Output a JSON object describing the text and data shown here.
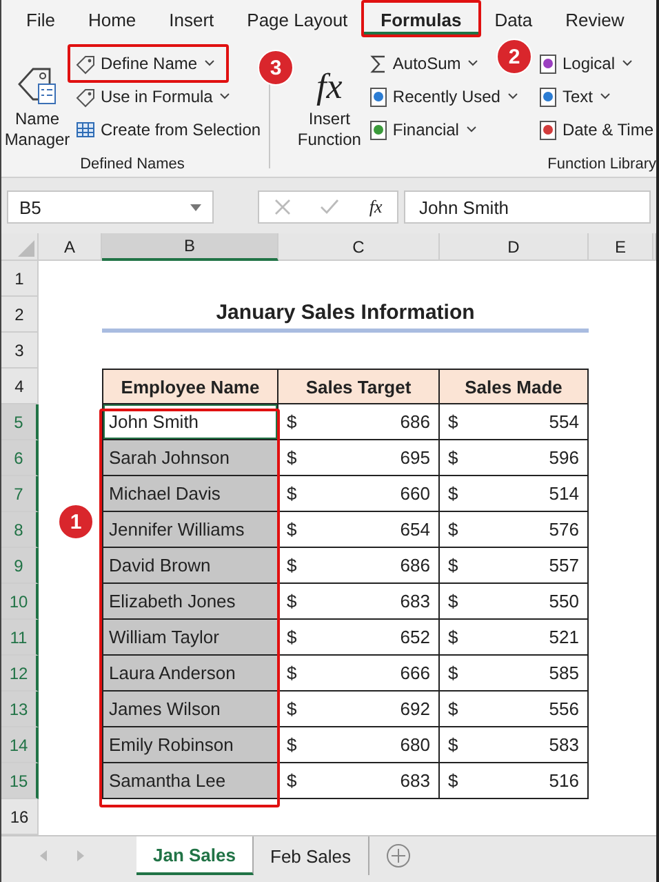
{
  "ribbon_tabs": [
    {
      "label": "File",
      "selected": false
    },
    {
      "label": "Home",
      "selected": false
    },
    {
      "label": "Insert",
      "selected": false
    },
    {
      "label": "Page Layout",
      "selected": false
    },
    {
      "label": "Formulas",
      "selected": true
    },
    {
      "label": "Data",
      "selected": false
    },
    {
      "label": "Review",
      "selected": false
    }
  ],
  "ribbon_groups": [
    {
      "label": "Defined Names",
      "large": [
        {
          "label": "Name Manager"
        }
      ],
      "small": [
        {
          "label": "Define Name",
          "dropdown": true
        },
        {
          "label": "Use in Formula",
          "dropdown": true
        },
        {
          "label": "Create from Selection",
          "dropdown": false
        }
      ]
    },
    {
      "label": "Function Library",
      "large": [
        {
          "label": "Insert Function",
          "glyph": "fx"
        }
      ],
      "small": [
        {
          "label": "AutoSum",
          "dropdown": true
        },
        {
          "label": "Recently Used",
          "dropdown": true
        },
        {
          "label": "Financial",
          "dropdown": true
        },
        {
          "label": "Logical",
          "dropdown": true
        },
        {
          "label": "Text",
          "dropdown": true
        },
        {
          "label": "Date & Time",
          "dropdown": false
        }
      ]
    }
  ],
  "formula_bar": {
    "name_box": "B5",
    "fx": "fx",
    "value": "John Smith"
  },
  "columns": [
    {
      "label": "A",
      "selected": false
    },
    {
      "label": "B",
      "selected": true
    },
    {
      "label": "C",
      "selected": false
    },
    {
      "label": "D",
      "selected": false
    },
    {
      "label": "E",
      "selected": false
    }
  ],
  "row_numbers": [
    {
      "label": "1",
      "selected": false
    },
    {
      "label": "2",
      "selected": false
    },
    {
      "label": "3",
      "selected": false
    },
    {
      "label": "4",
      "selected": false
    },
    {
      "label": "5",
      "selected": true
    },
    {
      "label": "6",
      "selected": true
    },
    {
      "label": "7",
      "selected": true
    },
    {
      "label": "8",
      "selected": true
    },
    {
      "label": "9",
      "selected": true
    },
    {
      "label": "10",
      "selected": true
    },
    {
      "label": "11",
      "selected": true
    },
    {
      "label": "12",
      "selected": true
    },
    {
      "label": "13",
      "selected": true
    },
    {
      "label": "14",
      "selected": true
    },
    {
      "label": "15",
      "selected": true
    },
    {
      "label": "16",
      "selected": false
    }
  ],
  "title": "January Sales Information",
  "table": {
    "columns": [
      "Employee Name",
      "Sales Target",
      "Sales Made"
    ],
    "rows": [
      {
        "name": "John Smith",
        "selected": true,
        "active": true,
        "target_currency": "$",
        "target": "686",
        "made_currency": "$",
        "made": "554"
      },
      {
        "name": "Sarah Johnson",
        "selected": true,
        "active": false,
        "target_currency": "$",
        "target": "695",
        "made_currency": "$",
        "made": "596"
      },
      {
        "name": "Michael Davis",
        "selected": true,
        "active": false,
        "target_currency": "$",
        "target": "660",
        "made_currency": "$",
        "made": "514"
      },
      {
        "name": "Jennifer Williams",
        "selected": true,
        "active": false,
        "target_currency": "$",
        "target": "654",
        "made_currency": "$",
        "made": "576"
      },
      {
        "name": "David Brown",
        "selected": true,
        "active": false,
        "target_currency": "$",
        "target": "686",
        "made_currency": "$",
        "made": "557"
      },
      {
        "name": "Elizabeth Jones",
        "selected": true,
        "active": false,
        "target_currency": "$",
        "target": "683",
        "made_currency": "$",
        "made": "550"
      },
      {
        "name": "William Taylor",
        "selected": true,
        "active": false,
        "target_currency": "$",
        "target": "652",
        "made_currency": "$",
        "made": "521"
      },
      {
        "name": "Laura Anderson",
        "selected": true,
        "active": false,
        "target_currency": "$",
        "target": "666",
        "made_currency": "$",
        "made": "585"
      },
      {
        "name": "James Wilson",
        "selected": true,
        "active": false,
        "target_currency": "$",
        "target": "692",
        "made_currency": "$",
        "made": "556"
      },
      {
        "name": "Emily Robinson",
        "selected": true,
        "active": false,
        "target_currency": "$",
        "target": "680",
        "made_currency": "$",
        "made": "583"
      },
      {
        "name": "Samantha Lee",
        "selected": true,
        "active": false,
        "target_currency": "$",
        "target": "683",
        "made_currency": "$",
        "made": "516"
      }
    ]
  },
  "sheet_tabs": [
    {
      "label": "Jan Sales",
      "selected": true
    },
    {
      "label": "Feb Sales",
      "selected": false
    }
  ],
  "callouts": [
    {
      "number": "1"
    },
    {
      "number": "2"
    },
    {
      "number": "3"
    }
  ]
}
